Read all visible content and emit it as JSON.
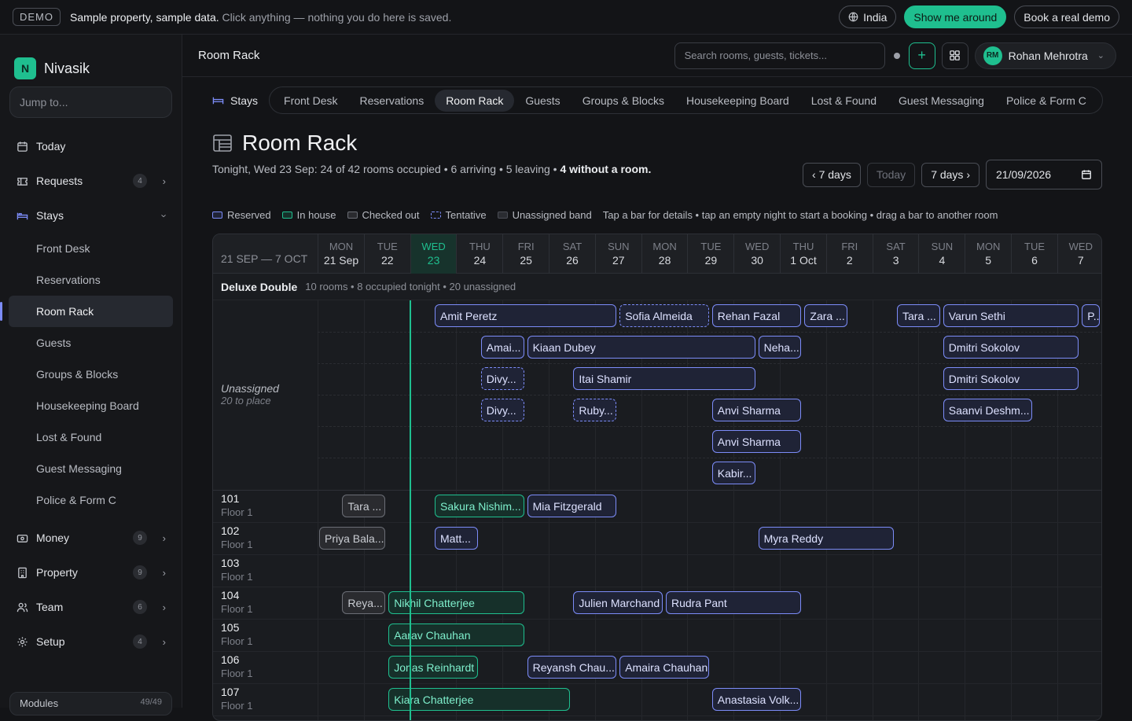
{
  "demo": {
    "badge": "DEMO",
    "bold": "Sample property, sample data.",
    "text": "Click anything — nothing you do here is saved.",
    "region": "India",
    "tour": "Show me around",
    "book": "Book a real demo"
  },
  "brand": {
    "name": "Nivasik",
    "logo": "N"
  },
  "sidebar": {
    "jump": "Jump to...",
    "items": [
      {
        "label": "Today",
        "icon": "calendar-icon"
      },
      {
        "label": "Requests",
        "icon": "ticket-icon",
        "count": "4"
      },
      {
        "label": "Stays",
        "icon": "bed-icon"
      }
    ],
    "subitems": [
      "Front Desk",
      "Reservations",
      "Room Rack",
      "Guests",
      "Groups & Blocks",
      "Housekeeping Board",
      "Lost & Found",
      "Guest Messaging",
      "Police & Form C"
    ],
    "lower": [
      {
        "label": "Money",
        "icon": "wallet-icon",
        "count": "9"
      },
      {
        "label": "Property",
        "icon": "building-icon",
        "count": "9"
      },
      {
        "label": "Team",
        "icon": "users-icon",
        "count": "6"
      },
      {
        "label": "Setup",
        "icon": "gear-icon",
        "count": "4"
      }
    ],
    "modules": "Modules",
    "modules_count": "49/49"
  },
  "topbar": {
    "title": "Room Rack",
    "search_placeholder": "Search rooms, guests, tickets...",
    "user_initials": "RM",
    "user_name": "Rohan Mehrotra"
  },
  "tabs": {
    "section": "Stays",
    "items": [
      "Front Desk",
      "Reservations",
      "Room Rack",
      "Guests",
      "Groups & Blocks",
      "Housekeeping Board",
      "Lost & Found",
      "Guest Messaging",
      "Police & Form C"
    ]
  },
  "page": {
    "title": "Room Rack",
    "subtitle": "Tonight, Wed 23 Sep: 24 of 42 rooms occupied • 6 arriving • 5 leaving •",
    "subtitle_bold": "4 without a room."
  },
  "datectl": {
    "prev": "‹ 7 days",
    "today": "Today",
    "next": "7 days ›",
    "date": "21/09/2026"
  },
  "legend": {
    "reserved": "Reserved",
    "inhouse": "In house",
    "out": "Checked out",
    "tentative": "Tentative",
    "unassigned": "Unassigned band",
    "hint": "Tap a bar for details • tap an empty night to start a booking • drag a bar to another room"
  },
  "colors": {
    "accent": "#1fbf8f",
    "reserved": "#7c8cf8",
    "checked_out": "#6b6e76"
  },
  "rack": {
    "range": "21 SEP — 7 OCT",
    "days": [
      [
        "MON",
        "21 Sep"
      ],
      [
        "TUE",
        "22"
      ],
      [
        "WED",
        "23"
      ],
      [
        "THU",
        "24"
      ],
      [
        "FRI",
        "25"
      ],
      [
        "SAT",
        "26"
      ],
      [
        "SUN",
        "27"
      ],
      [
        "MON",
        "28"
      ],
      [
        "TUE",
        "29"
      ],
      [
        "WED",
        "30"
      ],
      [
        "THU",
        "1 Oct"
      ],
      [
        "FRI",
        "2"
      ],
      [
        "SAT",
        "3"
      ],
      [
        "SUN",
        "4"
      ],
      [
        "MON",
        "5"
      ],
      [
        "TUE",
        "6"
      ],
      [
        "WED",
        "7"
      ]
    ],
    "today_index": 2,
    "section": {
      "name": "Deluxe Double",
      "info": "10 rooms • 8 occupied tonight • 20 unassigned"
    },
    "unassigned": {
      "label": "Unassigned",
      "sub": "20 to place",
      "rows": [
        [
          {
            "g": "Amit Peretz",
            "s": 2.5,
            "e": 6.5,
            "t": "res"
          },
          {
            "g": "Sofia Almeida",
            "s": 6.5,
            "e": 8.5,
            "t": "ten"
          },
          {
            "g": "Rehan Fazal",
            "s": 8.5,
            "e": 10.5,
            "t": "res"
          },
          {
            "g": "Zara ...",
            "s": 10.5,
            "e": 11.5,
            "t": "res"
          },
          {
            "g": "Tara ...",
            "s": 12.5,
            "e": 13.5,
            "t": "res"
          },
          {
            "g": "Varun Sethi",
            "s": 13.5,
            "e": 16.5,
            "t": "res"
          },
          {
            "g": "P...",
            "s": 16.5,
            "e": 17,
            "t": "res"
          }
        ],
        [
          {
            "g": "Amai...",
            "s": 3.5,
            "e": 4.5,
            "t": "res"
          },
          {
            "g": "Kiaan Dubey",
            "s": 4.5,
            "e": 9.5,
            "t": "res"
          },
          {
            "g": "Neha...",
            "s": 9.5,
            "e": 10.5,
            "t": "res"
          },
          {
            "g": "Dmitri Sokolov",
            "s": 13.5,
            "e": 16.5,
            "t": "res"
          }
        ],
        [
          {
            "g": "Divy...",
            "s": 3.5,
            "e": 4.5,
            "t": "ten"
          },
          {
            "g": "Itai Shamir",
            "s": 5.5,
            "e": 9.5,
            "t": "res"
          },
          {
            "g": "Dmitri Sokolov",
            "s": 13.5,
            "e": 16.5,
            "t": "res"
          }
        ],
        [
          {
            "g": "Divy...",
            "s": 3.5,
            "e": 4.5,
            "t": "ten"
          },
          {
            "g": "Ruby...",
            "s": 5.5,
            "e": 6.5,
            "t": "ten"
          },
          {
            "g": "Anvi Sharma",
            "s": 8.5,
            "e": 10.5,
            "t": "res"
          },
          {
            "g": "Saanvi Deshm...",
            "s": 13.5,
            "e": 15.5,
            "t": "res"
          }
        ],
        [
          {
            "g": "Anvi Sharma",
            "s": 8.5,
            "e": 10.5,
            "t": "res"
          }
        ],
        [
          {
            "g": "Kabir...",
            "s": 8.5,
            "e": 9.5,
            "t": "res"
          }
        ]
      ]
    },
    "rooms": [
      {
        "no": "101",
        "floor": "Floor 1",
        "bars": [
          {
            "g": "Tara ...",
            "s": 0.5,
            "e": 1.5,
            "t": "out"
          },
          {
            "g": "Sakura Nishim...",
            "s": 2.5,
            "e": 4.5,
            "t": "in"
          },
          {
            "g": "Mia Fitzgerald",
            "s": 4.5,
            "e": 6.5,
            "t": "res"
          }
        ]
      },
      {
        "no": "102",
        "floor": "Floor 1",
        "bars": [
          {
            "g": "Priya Bala...",
            "s": 0,
            "e": 1.5,
            "t": "out"
          },
          {
            "g": "Matt...",
            "s": 2.5,
            "e": 3.5,
            "t": "res"
          },
          {
            "g": "Myra Reddy",
            "s": 9.5,
            "e": 12.5,
            "t": "res"
          }
        ]
      },
      {
        "no": "103",
        "floor": "Floor 1",
        "bars": []
      },
      {
        "no": "104",
        "floor": "Floor 1",
        "bars": [
          {
            "g": "Reya...",
            "s": 0.5,
            "e": 1.5,
            "t": "out"
          },
          {
            "g": "Nikhil Chatterjee",
            "s": 1.5,
            "e": 4.5,
            "t": "in"
          },
          {
            "g": "Julien Marchand",
            "s": 5.5,
            "e": 7.5,
            "t": "res"
          },
          {
            "g": "Rudra Pant",
            "s": 7.5,
            "e": 10.5,
            "t": "res"
          }
        ]
      },
      {
        "no": "105",
        "floor": "Floor 1",
        "bars": [
          {
            "g": "Aarav Chauhan",
            "s": 1.5,
            "e": 4.5,
            "t": "in"
          }
        ]
      },
      {
        "no": "106",
        "floor": "Floor 1",
        "bars": [
          {
            "g": "Jonas Reinhardt",
            "s": 1.5,
            "e": 3.5,
            "t": "in"
          },
          {
            "g": "Reyansh Chau...",
            "s": 4.5,
            "e": 6.5,
            "t": "res"
          },
          {
            "g": "Amaira Chauhan",
            "s": 6.5,
            "e": 8.5,
            "t": "res"
          }
        ]
      },
      {
        "no": "107",
        "floor": "Floor 1",
        "bars": [
          {
            "g": "Kiara Chatterjee",
            "s": 1.5,
            "e": 5.5,
            "t": "in"
          },
          {
            "g": "Anastasia Volk...",
            "s": 8.5,
            "e": 10.5,
            "t": "res"
          }
        ]
      }
    ]
  }
}
